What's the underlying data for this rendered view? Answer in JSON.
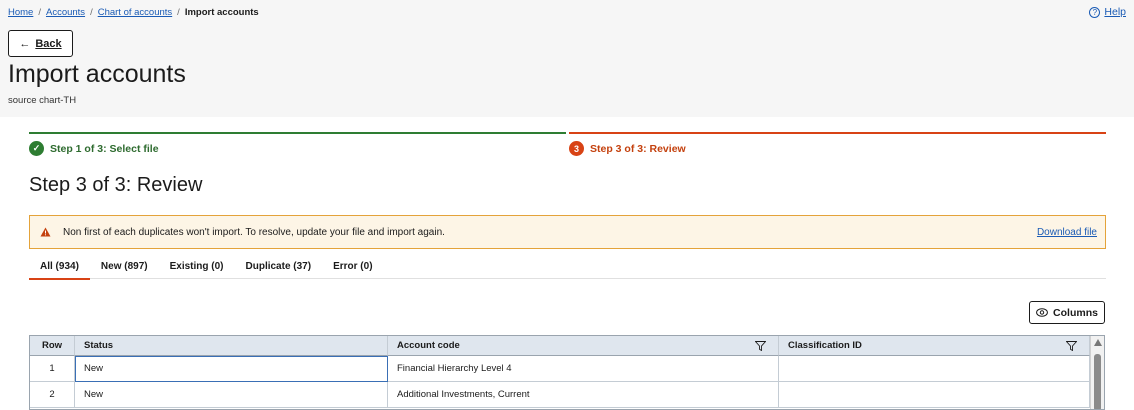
{
  "breadcrumb": {
    "home": "Home",
    "accounts": "Accounts",
    "chart": "Chart of accounts",
    "current": "Import accounts",
    "sep": "/"
  },
  "help": {
    "label": "Help",
    "icon_glyph": "?"
  },
  "back": {
    "label": "Back",
    "icon": "arrow-left-icon"
  },
  "page": {
    "title": "Import accounts",
    "subtitle": "source chart-TH"
  },
  "steps": [
    {
      "label": "Step 1 of 3: Select file",
      "state": "complete",
      "icon": "check-circle-icon"
    },
    {
      "label": "Step 3 of 3: Review",
      "state": "current",
      "number": "3"
    }
  ],
  "section_title": "Step 3 of 3: Review",
  "alert": {
    "message": "Non first of each duplicates won't import. To resolve, update your file and import again.",
    "link": "Download file",
    "icon": "warning-icon"
  },
  "tabs": [
    {
      "label": "All (934)",
      "active": true
    },
    {
      "label": "New (897)"
    },
    {
      "label": "Existing (0)"
    },
    {
      "label": "Duplicate (37)"
    },
    {
      "label": "Error (0)"
    }
  ],
  "columns_button": {
    "label": "Columns",
    "icon": "eye-icon"
  },
  "table": {
    "headers": {
      "row": "Row",
      "status": "Status",
      "code": "Account code",
      "classification": "Classification ID"
    },
    "rows": [
      {
        "row": "1",
        "status": "New",
        "code": "Financial Hierarchy Level 4",
        "classification": ""
      },
      {
        "row": "2",
        "status": "New",
        "code": "Additional Investments, Current",
        "classification": ""
      }
    ]
  },
  "colors": {
    "success": "#2e7d32",
    "accent": "#d84315",
    "link": "#1a5bb5",
    "warning": "#e4a33a"
  }
}
